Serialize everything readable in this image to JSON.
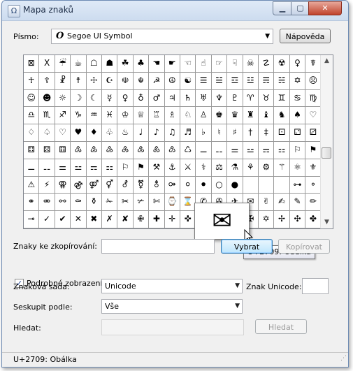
{
  "window": {
    "title": "Mapa znaků",
    "icon": "charmap-app-icon",
    "min_glyph": "▁",
    "max_glyph": "▢",
    "close_glyph": "✕"
  },
  "font_label": "Písmo:",
  "font_name": "Segoe UI Symbol",
  "font_glyph": "O",
  "help_button": "Nápověda",
  "grid_rows": [
    [
      "⊠",
      "Ⅹ",
      "☔",
      "☕",
      "☖",
      "☗",
      "☘",
      "♣",
      "☚",
      "☛",
      "☜",
      "☝",
      "☞",
      "☟",
      "☠",
      "☡",
      "☢",
      "♀",
      "☤"
    ],
    [
      "☥",
      "☦",
      "☧",
      "☨",
      "☩",
      "☪",
      "☫",
      "☬",
      "☭",
      "☮",
      "☯",
      "☰",
      "☱",
      "☲",
      "☳",
      "☴",
      "☵",
      "✡",
      "☹"
    ],
    [
      "☺",
      "☻",
      "☼",
      "☽",
      "☾",
      "☿",
      "♀",
      "♁",
      "♂",
      "♃",
      "♄",
      "♅",
      "♆",
      "♇",
      "♈",
      "♉",
      "♊",
      "♋",
      "♍"
    ],
    [
      "♎",
      "♏",
      "♐",
      "♑",
      "♒",
      "♓",
      "♔",
      "♕",
      "♖",
      "♗",
      "♘",
      "♙",
      "♚",
      "♛",
      "♜",
      "♝",
      "♞",
      "♠",
      "♡"
    ],
    [
      "♢",
      "♤",
      "♡",
      "♥",
      "♦",
      "♧",
      "♨",
      "♩",
      "♪",
      "♫",
      "♬",
      "♭",
      "♮",
      "♯",
      "†",
      "‡",
      "⚀",
      "⚁",
      "⚂"
    ],
    [
      "⚃",
      "⚄",
      "⚅",
      "♳",
      "♴",
      "♵",
      "♶",
      "♷",
      "♸",
      "♹",
      "♺",
      "⚊",
      "⚋",
      "⚌",
      "⚍",
      "⚎",
      "⚏",
      "⚐",
      "⚑"
    ],
    [
      "⚊",
      "⚋",
      "⚌",
      "⚍",
      "⚎",
      "⚏",
      "⚐",
      "⚑",
      "⚒",
      "⚓",
      "⚔",
      "⚕",
      "⚖",
      "⚗",
      "⚘",
      "⚙",
      "⚚",
      "⚛",
      "⚜"
    ],
    [
      "⚠",
      "⚡",
      "⚢",
      "⚣",
      "⚤",
      "⚥",
      "⚦",
      "⚧",
      "⚨",
      "⚩",
      "⚪",
      "⚫",
      "○",
      "●",
      "",
      "",
      "",
      "⊶",
      "⚬"
    ],
    [
      "⚭",
      "⚮",
      "⚯",
      "⚰",
      "⚱",
      "✁",
      "✂",
      "✃",
      "✄",
      "⌚",
      "⌛",
      "✆",
      "✇",
      "✈",
      "✉",
      "✌",
      "✍",
      "✎",
      "✏"
    ],
    [
      "⊸",
      "✓",
      "✔",
      "✕",
      "✖",
      "✗",
      "✘",
      "✙",
      "✚",
      "✛",
      "✜",
      "✝",
      "✞",
      "✟",
      "✠",
      "✡",
      "✢",
      "✣",
      "✤"
    ]
  ],
  "magnified_char": "✉",
  "tooltip": "U+2709: Obálka",
  "copy_label": "Znaky ke zkopírování:",
  "copy_value": "",
  "select_button": "Vybrat",
  "copy_button": "Kopírovat",
  "advanced_checkbox": {
    "label": "Podrobné zobrazení",
    "checked": true,
    "mark": "✓"
  },
  "charset_label": "Znaková sada:",
  "charset_value": "Unicode",
  "unicode_label": "Znak Unicode:",
  "unicode_value": "",
  "groupby_label": "Seskupit podle:",
  "groupby_value": "Vše",
  "search_label": "Hledat:",
  "search_value": "",
  "search_button": "Hledat",
  "status_text": "U+2709: Obálka",
  "dropdown_glyph": "▼",
  "scroll_up_glyph": "▲",
  "scroll_down_glyph": "▼",
  "grip_glyph": "⋰"
}
